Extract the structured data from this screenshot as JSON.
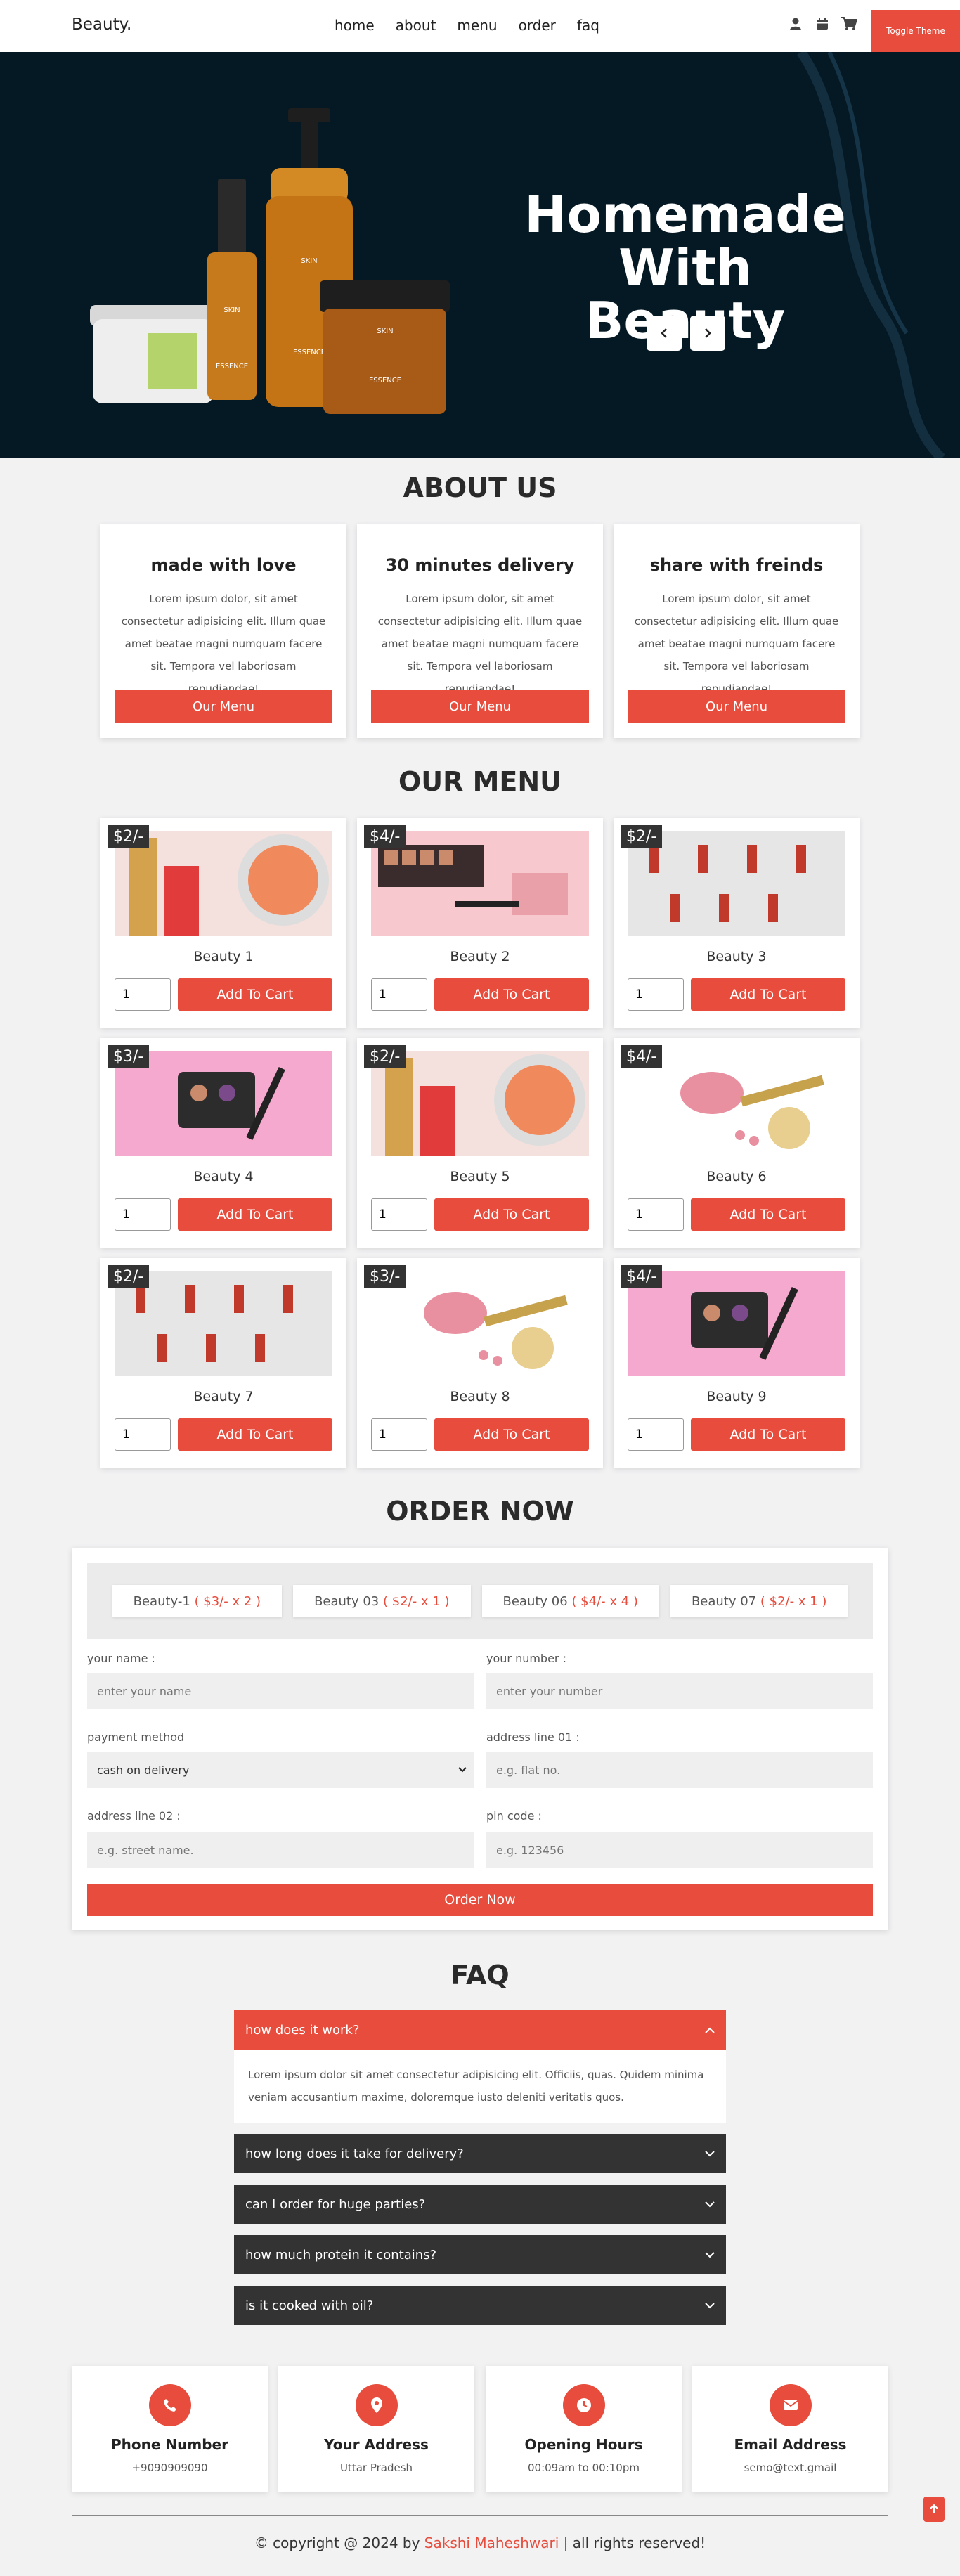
{
  "header": {
    "logo": "Beauty.",
    "nav": [
      "home",
      "about",
      "menu",
      "order",
      "faq"
    ],
    "toggle_label": "Toggle Theme",
    "icons": [
      "user-icon",
      "calendar-icon",
      "cart-icon"
    ]
  },
  "hero": {
    "title_line1": "Homemade",
    "title_line2": "With Beauty",
    "prev_icon": "chevron-left-icon",
    "next_icon": "chevron-right-icon",
    "product_labels": [
      "SKIN",
      "ESSENCE",
      "SKIN",
      "ESSENCE",
      "SKIN",
      "ESSENCE"
    ]
  },
  "about": {
    "heading": "ABOUT US",
    "cards": [
      {
        "title": "made with love",
        "text": "Lorem ipsum dolor, sit amet consectetur adipisicing elit. Illum quae amet beatae magni numquam facere sit. Tempora vel laboriosam repudiandae!",
        "button": "Our Menu"
      },
      {
        "title": "30 minutes delivery",
        "text": "Lorem ipsum dolor, sit amet consectetur adipisicing elit. Illum quae amet beatae magni numquam facere sit. Tempora vel laboriosam repudiandae!",
        "button": "Our Menu"
      },
      {
        "title": "share with freinds",
        "text": "Lorem ipsum dolor, sit amet consectetur adipisicing elit. Illum quae amet beatae magni numquam facere sit. Tempora vel laboriosam repudiandae!",
        "button": "Our Menu"
      }
    ]
  },
  "menu": {
    "heading": "OUR MENU",
    "button": "Add To Cart",
    "items": [
      {
        "name": "Beauty 1",
        "price": "$2/-",
        "qty": "1"
      },
      {
        "name": "Beauty 2",
        "price": "$4/-",
        "qty": "1"
      },
      {
        "name": "Beauty 3",
        "price": "$2/-",
        "qty": "1"
      },
      {
        "name": "Beauty 4",
        "price": "$3/-",
        "qty": "1"
      },
      {
        "name": "Beauty 5",
        "price": "$2/-",
        "qty": "1"
      },
      {
        "name": "Beauty 6",
        "price": "$4/-",
        "qty": "1"
      },
      {
        "name": "Beauty 7",
        "price": "$2/-",
        "qty": "1"
      },
      {
        "name": "Beauty 8",
        "price": "$3/-",
        "qty": "1"
      },
      {
        "name": "Beauty 9",
        "price": "$4/-",
        "qty": "1"
      }
    ]
  },
  "order": {
    "heading": "ORDER NOW",
    "chips": [
      {
        "name": "Beauty-1",
        "detail": "( $3/- x 2 )"
      },
      {
        "name": "Beauty 03",
        "detail": "( $2/- x 1 )"
      },
      {
        "name": "Beauty 06",
        "detail": "( $4/- x 4 )"
      },
      {
        "name": "Beauty 07",
        "detail": "( $2/- x 1 )"
      }
    ],
    "name_label": "your name :",
    "name_placeholder": "enter your name",
    "number_label": "your number :",
    "number_placeholder": "enter your number",
    "payment_label": "payment method",
    "payment_value": "cash on delivery",
    "addr1_label": "address line 01 :",
    "addr1_placeholder": "e.g. flat no.",
    "addr2_label": "address line 02 :",
    "addr2_placeholder": "e.g. street name.",
    "pin_label": "pin code :",
    "pin_placeholder": "e.g. 123456",
    "submit": "Order Now"
  },
  "faq": {
    "heading": "FAQ",
    "items": [
      {
        "q": "how does it work?",
        "a": "Lorem ipsum dolor sit amet consectetur adipisicing elit. Officiis, quas. Quidem minima veniam accusantium maxime, doloremque iusto deleniti veritatis quos.",
        "open": true
      },
      {
        "q": "how long does it take for delivery?",
        "open": false
      },
      {
        "q": "can I order for huge parties?",
        "open": false
      },
      {
        "q": "how much protein it contains?",
        "open": false
      },
      {
        "q": "is it cooked with oil?",
        "open": false
      }
    ]
  },
  "contact": [
    {
      "title": "Phone Number",
      "value": "+9090909090",
      "icon": "phone-icon"
    },
    {
      "title": "Your Address",
      "value": "Uttar Pradesh",
      "icon": "location-pin-icon"
    },
    {
      "title": "Opening Hours",
      "value": "00:09am to 00:10pm",
      "icon": "clock-icon"
    },
    {
      "title": "Email Address",
      "value": "semo@text.gmail",
      "icon": "envelope-icon"
    }
  ],
  "footer": {
    "prefix": "© copyright @ 2024 by",
    "author": "Sakshi Maheshwari",
    "suffix": "| all rights reserved!"
  },
  "colors": {
    "accent": "#e74c3c",
    "hero_bg": "#051924",
    "dark": "#333333"
  }
}
